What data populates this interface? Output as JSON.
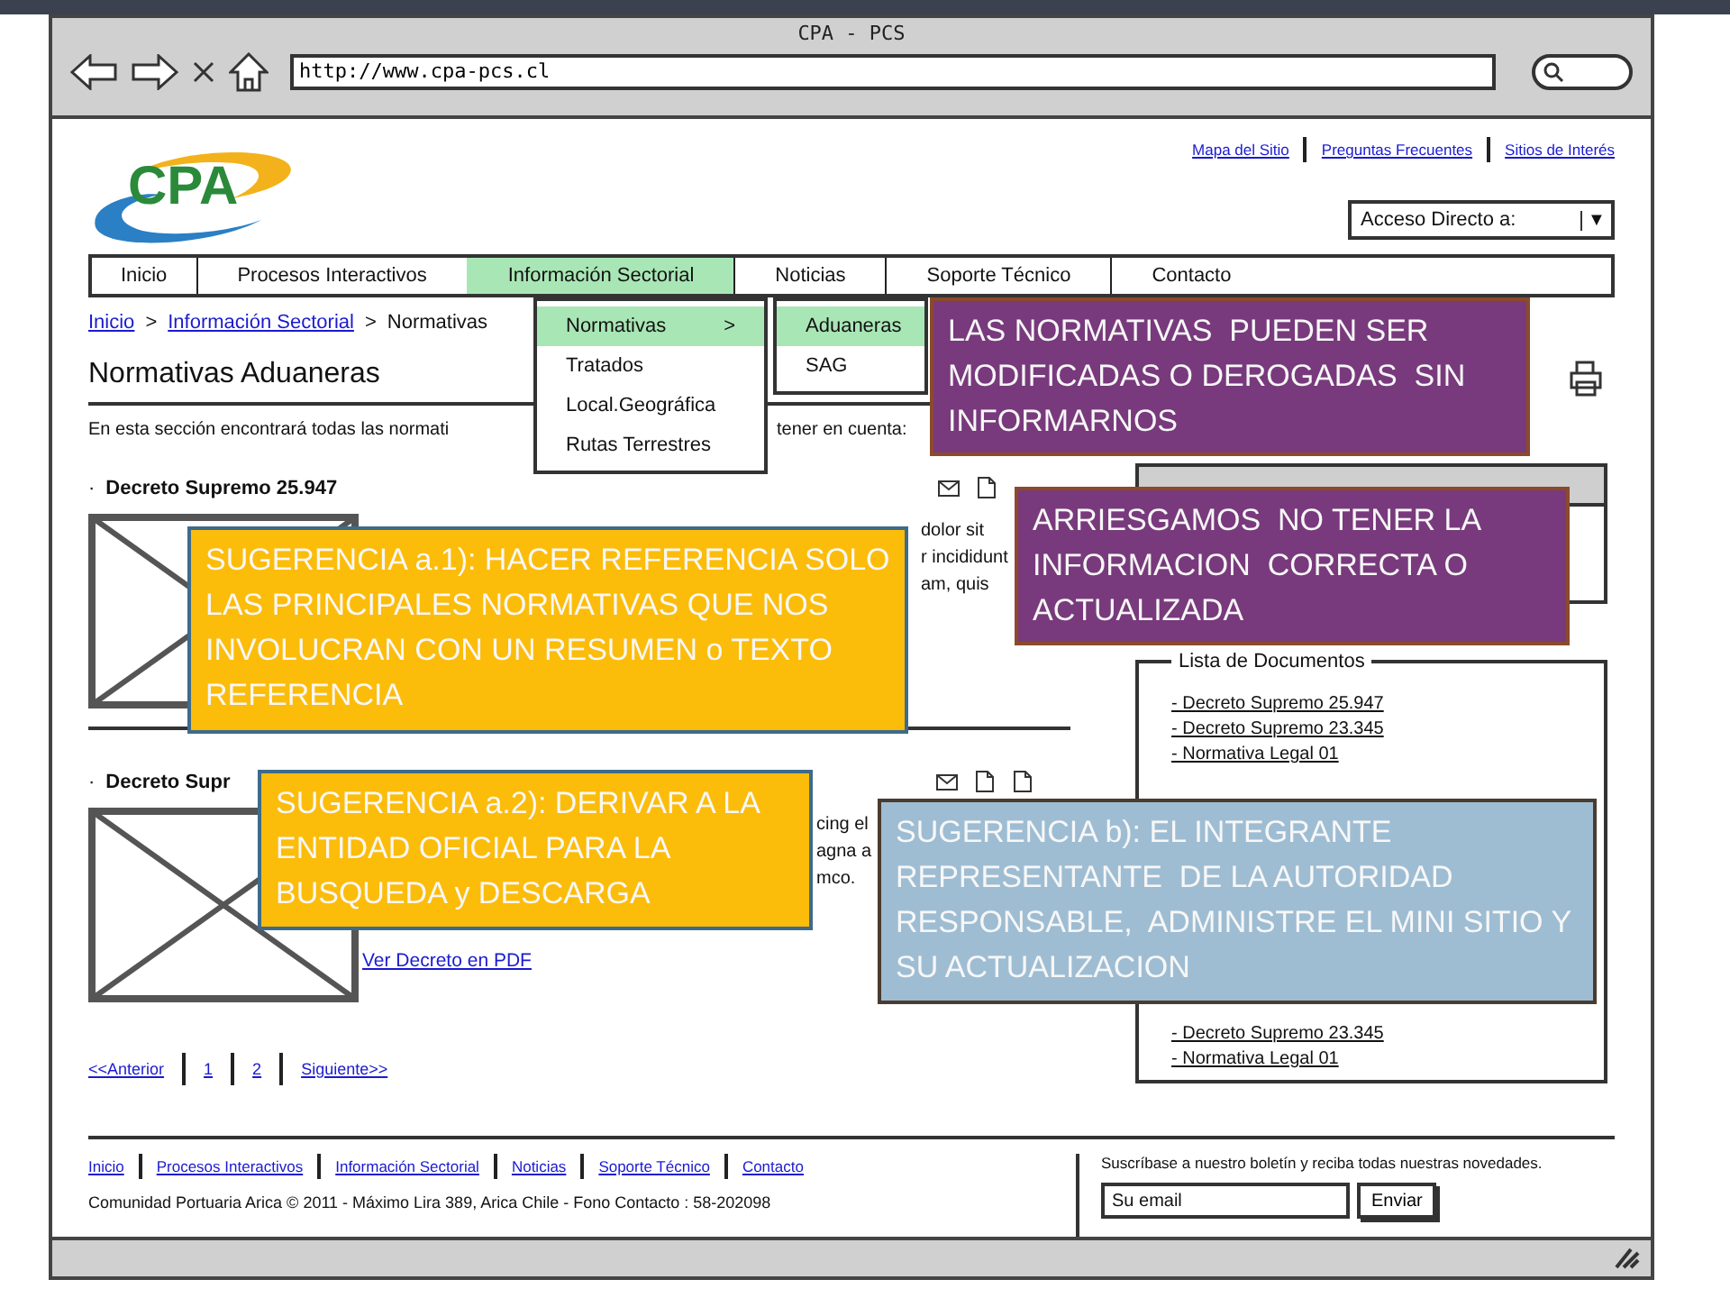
{
  "window": {
    "title": "CPA - PCS",
    "url": "http://www.cpa-pcs.cl"
  },
  "header": {
    "logo": "CPA",
    "top_links": [
      "Mapa del Sitio",
      "Preguntas Frecuentes",
      "Sitios de Interés"
    ],
    "quick_access": "Acceso Directo a:",
    "dropdown_arrow": "▼"
  },
  "nav": [
    {
      "label": "Inicio",
      "selected": false
    },
    {
      "label": "Procesos Interactivos",
      "selected": false
    },
    {
      "label": "Información Sectorial",
      "selected": true
    },
    {
      "label": "Noticias",
      "selected": false
    },
    {
      "label": "Soporte Técnico",
      "selected": false
    },
    {
      "label": "Contacto",
      "selected": false
    }
  ],
  "menu": {
    "items": [
      {
        "label": "Normativas",
        "selected": true,
        "arrow": ">"
      },
      {
        "label": "Tratados",
        "selected": false
      },
      {
        "label": "Local.Geográfica",
        "selected": false
      },
      {
        "label": "Rutas Terrestres",
        "selected": false
      }
    ],
    "submenu": [
      {
        "label": "Aduaneras",
        "selected": true
      },
      {
        "label": "SAG",
        "selected": false
      }
    ]
  },
  "breadcrumb": {
    "links": [
      "Inicio",
      "Información Sectorial"
    ],
    "current": "Normativas",
    "separator": ">"
  },
  "page_title": "Normativas Aduaneras",
  "intro": [
    "En esta sección encontrará todas las normati",
    "tener en cuenta:"
  ],
  "decrees": [
    {
      "bullet": "·",
      "title": "Decreto Supremo 25.947",
      "text_lines": [
        "dolor sit",
        "r incididunt",
        "am, quis"
      ]
    },
    {
      "bullet": "·",
      "title": "Decreto Supr",
      "text_lines": [
        "cing el",
        "agna a",
        "mco."
      ],
      "link": "Ver Decreto en PDF"
    }
  ],
  "pagination": [
    "<<Anterior",
    "1",
    "2",
    "Siguiente>>"
  ],
  "sidebar": {
    "documents_title": "Lista de Documentos",
    "documents": [
      "- Decreto Supremo 25.947",
      "- Decreto Supremo 23.345",
      "- Normativa Legal 01"
    ],
    "documents_more": [
      "- Decreto Supremo 23.345",
      "- Normativa Legal 01"
    ]
  },
  "footer": {
    "links": [
      "Inicio",
      "Procesos Interactivos",
      "Información Sectorial",
      "Noticias",
      "Soporte Técnico",
      "Contacto"
    ],
    "copyright": "Comunidad Portuaria Arica © 2011 - Máximo Lira 389, Arica Chile - Fono Contacto : 58-202098",
    "newsletter": "Suscríbase a nuestro boletín y reciba todas nuestras novedades.",
    "email_placeholder": "Su email",
    "submit": "Enviar"
  },
  "notes": [
    {
      "text": "LAS NORMATIVAS  PUEDEN SER MODIFICADAS O DEROGADAS  SIN INFORMARNOS",
      "color": "#783a7c"
    },
    {
      "text": "ARRIESGAMOS  NO TENER LA INFORMACION  CORRECTA O ACTUALIZADA",
      "color": "#783a7c"
    },
    {
      "text": "SUGERENCIA a.1): HACER REFERENCIA SOLO LAS PRINCIPALES NORMATIVAS QUE NOS INVOLUCRAN CON UN RESUMEN o TEXTO REFERENCIA",
      "color": "#fcbc0a"
    },
    {
      "text": "SUGERENCIA a.2): DERIVAR A LA ENTIDAD OFICIAL PARA LA BUSQUEDA y DESCARGA",
      "color": "#fcbc0a"
    },
    {
      "text": "SUGERENCIA b): EL INTEGRANTE REPRESENTANTE  DE LA AUTORIDAD RESPONSABLE,  ADMINISTRE EL MINI SITIO Y SU ACTUALIZACION",
      "color": "#9ebdd3"
    }
  ]
}
